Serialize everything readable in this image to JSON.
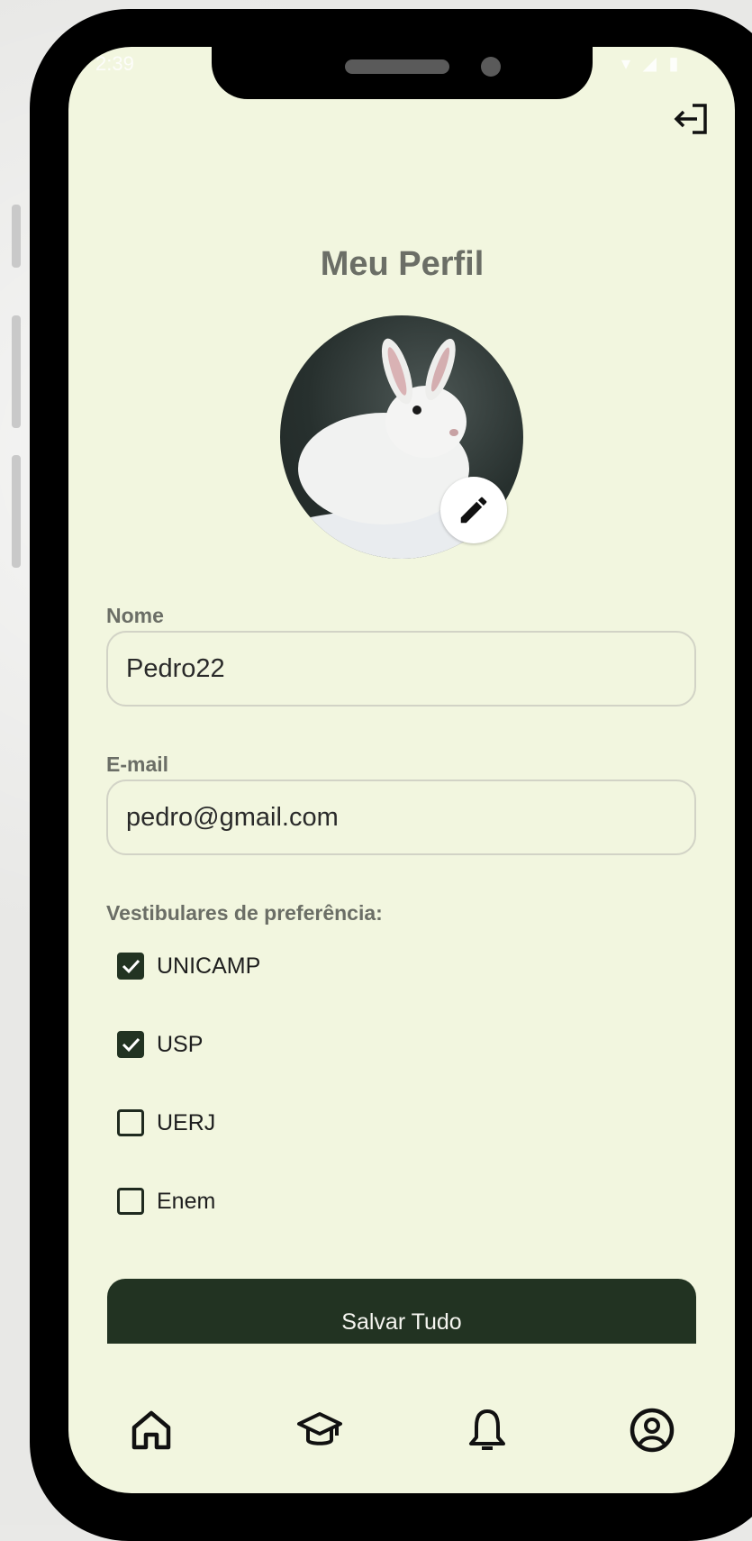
{
  "status_bar": {
    "time": "2:39",
    "indicators": "▾ ◢ ▮"
  },
  "page": {
    "title": "Meu Perfil"
  },
  "form": {
    "name_label": "Nome",
    "name_value": "Pedro22",
    "email_label": "E-mail",
    "email_value": "pedro@gmail.com",
    "prefs_label": "Vestibulares de preferência:",
    "options": [
      {
        "label": "UNICAMP",
        "checked": true
      },
      {
        "label": "USP",
        "checked": true
      },
      {
        "label": "UERJ",
        "checked": false
      },
      {
        "label": "Enem",
        "checked": false
      }
    ]
  },
  "actions": {
    "save_label": "Salvar Tudo"
  },
  "icons": {
    "logout": "logout-icon",
    "edit": "pencil-icon",
    "nav": [
      "home-icon",
      "graduation-cap-icon",
      "bell-icon",
      "profile-icon"
    ]
  },
  "colors": {
    "background": "#f2f6df",
    "accent_dark_green": "#223322",
    "label_gray": "#6b6e66"
  }
}
